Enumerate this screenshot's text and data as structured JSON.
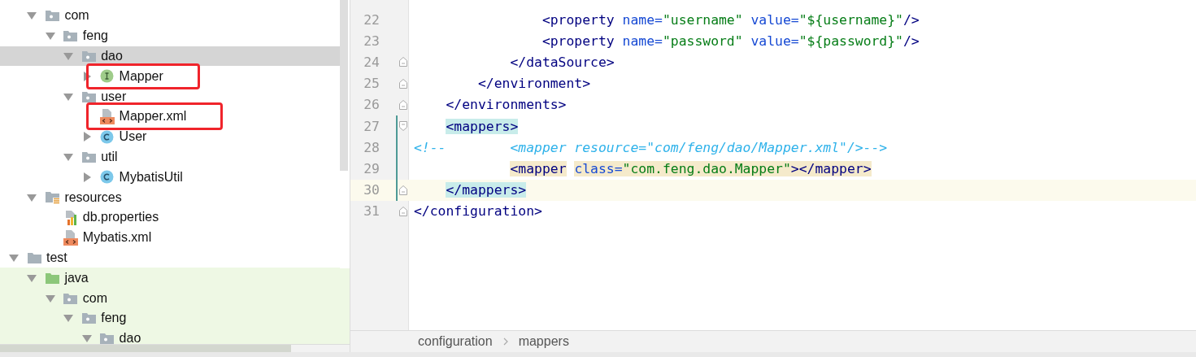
{
  "project_tree": [
    {
      "children": [
        {
          "label": "com",
          "kind": "package",
          "expanded": true,
          "selected": false,
          "highlighted": false,
          "children": [
            {
              "label": "feng",
              "kind": "package",
              "expanded": true,
              "selected": false,
              "highlighted": false,
              "children": [
                {
                  "label": "dao",
                  "kind": "package",
                  "expanded": true,
                  "selected": true,
                  "highlighted": false,
                  "children": [
                    {
                      "label": "Mapper",
                      "kind": "interface",
                      "expanded": false,
                      "selected": false,
                      "highlighted": true
                    }
                  ]
                },
                {
                  "label": "user",
                  "kind": "package",
                  "expanded": true,
                  "selected": false,
                  "highlighted": false,
                  "children": [
                    {
                      "label": "Mapper.xml",
                      "kind": "xml",
                      "selected": false,
                      "highlighted": true
                    },
                    {
                      "label": "User",
                      "kind": "class",
                      "expanded": false,
                      "selected": false,
                      "highlighted": false
                    }
                  ]
                },
                {
                  "label": "util",
                  "kind": "package",
                  "expanded": true,
                  "selected": false,
                  "highlighted": false,
                  "children": [
                    {
                      "label": "MybatisUtil",
                      "kind": "class",
                      "expanded": false,
                      "selected": false,
                      "highlighted": false
                    }
                  ]
                }
              ]
            }
          ]
        },
        {
          "label": "resources",
          "kind": "resources",
          "expanded": true,
          "selected": false,
          "highlighted": false,
          "children": [
            {
              "label": "db.properties",
              "kind": "properties",
              "selected": false,
              "highlighted": false
            },
            {
              "label": "Mybatis.xml",
              "kind": "xml",
              "selected": false,
              "highlighted": false
            }
          ]
        }
      ]
    },
    {
      "label": "test",
      "kind": "folder",
      "expanded": true,
      "selected": false,
      "highlighted": false,
      "children": [
        {
          "label": "java",
          "kind": "test-root",
          "expanded": true,
          "selected": false,
          "highlighted": false,
          "children": [
            {
              "label": "com",
              "kind": "package",
              "expanded": true,
              "selected": false,
              "highlighted": false,
              "children": [
                {
                  "label": "feng",
                  "kind": "package",
                  "expanded": true,
                  "selected": false,
                  "highlighted": false,
                  "children": [
                    {
                      "label": "dao",
                      "kind": "package",
                      "expanded": true,
                      "selected": false,
                      "highlighted": false
                    }
                  ]
                }
              ]
            }
          ]
        }
      ]
    }
  ],
  "editor": {
    "lines": [
      {
        "number": "22",
        "kind": "plain",
        "current": false,
        "changed": false,
        "tokens": [
          {
            "kind": "tag",
            "text": "                <property",
            "matched": false,
            "highlighted": false
          },
          {
            "kind": "attr",
            "text": " name=",
            "matched": false,
            "highlighted": false
          },
          {
            "kind": "value",
            "text": "\"username\"",
            "matched": false,
            "highlighted": false
          },
          {
            "kind": "attr",
            "text": " value=",
            "matched": false,
            "highlighted": false
          },
          {
            "kind": "value",
            "text": "\"${username}\"",
            "matched": false,
            "highlighted": false
          },
          {
            "kind": "tag",
            "text": "/>",
            "matched": false,
            "highlighted": false
          }
        ]
      },
      {
        "number": "23",
        "kind": "plain",
        "current": false,
        "changed": false,
        "tokens": [
          {
            "kind": "tag",
            "text": "                <property",
            "matched": false,
            "highlighted": false
          },
          {
            "kind": "attr",
            "text": " name=",
            "matched": false,
            "highlighted": false
          },
          {
            "kind": "value",
            "text": "\"password\"",
            "matched": false,
            "highlighted": false
          },
          {
            "kind": "attr",
            "text": " value=",
            "matched": false,
            "highlighted": false
          },
          {
            "kind": "value",
            "text": "\"${password}\"",
            "matched": false,
            "highlighted": false
          },
          {
            "kind": "tag",
            "text": "/>",
            "matched": false,
            "highlighted": false
          }
        ]
      },
      {
        "number": "24",
        "kind": "fold-end",
        "current": false,
        "changed": false,
        "tokens": [
          {
            "kind": "tag",
            "text": "            </dataSource>",
            "matched": false,
            "highlighted": false
          }
        ]
      },
      {
        "number": "25",
        "kind": "fold-end",
        "current": false,
        "changed": false,
        "tokens": [
          {
            "kind": "tag",
            "text": "        </environment>",
            "matched": false,
            "highlighted": false
          }
        ]
      },
      {
        "number": "26",
        "kind": "fold-end",
        "current": false,
        "changed": false,
        "tokens": [
          {
            "kind": "tag",
            "text": "    </environments>",
            "matched": false,
            "highlighted": false
          }
        ]
      },
      {
        "number": "27",
        "kind": "fold-start",
        "current": false,
        "changed": true,
        "tokens": [
          {
            "kind": "tag",
            "text": "    <mappers>",
            "matched": true,
            "highlighted": false
          }
        ]
      },
      {
        "number": "28",
        "kind": "plain",
        "current": false,
        "changed": true,
        "tokens": [
          {
            "kind": "comment",
            "text": "<!--",
            "matched": false,
            "highlighted": false
          },
          {
            "kind": "comment",
            "text": "        <mapper resource=\"com/feng/dao/Mapper.xml\"/>-->",
            "matched": false,
            "highlighted": false
          }
        ]
      },
      {
        "number": "29",
        "kind": "plain",
        "current": false,
        "changed": true,
        "tokens": [
          {
            "kind": "tag",
            "text": "            <mapper",
            "matched": false,
            "highlighted": true
          },
          {
            "kind": "attr",
            "text": " class=",
            "matched": false,
            "highlighted": true
          },
          {
            "kind": "value",
            "text": "\"com.feng.dao.Mapper\"",
            "matched": false,
            "highlighted": true
          },
          {
            "kind": "tag",
            "text": "></mapper>",
            "matched": false,
            "highlighted": true
          }
        ]
      },
      {
        "number": "30",
        "kind": "fold-end",
        "current": true,
        "changed": true,
        "tokens": [
          {
            "kind": "tag",
            "text": "    </mappers>",
            "matched": true,
            "highlighted": false
          }
        ]
      },
      {
        "number": "31",
        "kind": "fold-end",
        "current": false,
        "changed": false,
        "tokens": [
          {
            "kind": "tag",
            "text": "</configuration>",
            "matched": false,
            "highlighted": false
          }
        ]
      }
    ]
  },
  "breadcrumbs": [
    "configuration",
    "mappers"
  ]
}
